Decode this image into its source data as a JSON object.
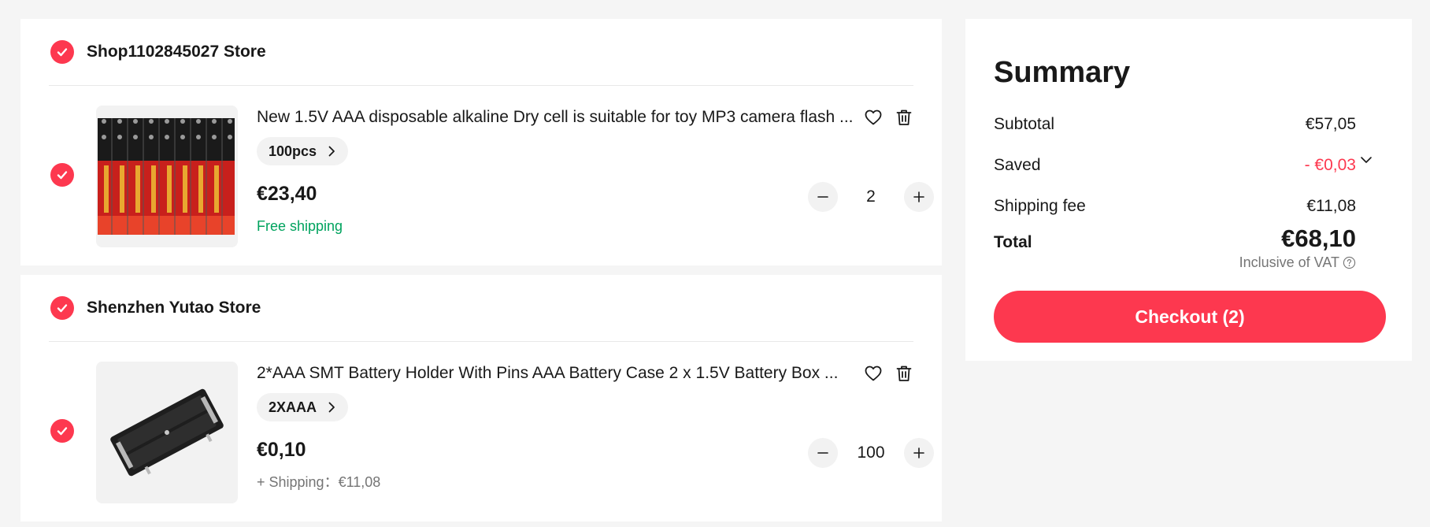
{
  "stores": [
    {
      "name": "Shop1102845027 Store",
      "item": {
        "title": "New 1.5V AAA disposable alkaline Dry cell is suitable for toy MP3 camera flash ...",
        "sku": "100pcs",
        "price": "€23,40",
        "shipping": "Free shipping",
        "quantity": "2"
      }
    },
    {
      "name": "Shenzhen Yutao Store",
      "item": {
        "title": "2*AAA SMT Battery Holder With Pins AAA Battery Case 2 x 1.5V Battery Box ...",
        "sku": "2XAAA",
        "price": "€0,10",
        "shipping": "+ Shipping：€11,08",
        "quantity": "100"
      }
    }
  ],
  "summary": {
    "title": "Summary",
    "subtotal_label": "Subtotal",
    "subtotal_value": "€57,05",
    "saved_label": "Saved",
    "saved_value": "- €0,03",
    "shipping_label": "Shipping fee",
    "shipping_value": "€11,08",
    "total_label": "Total",
    "total_value": "€68,10",
    "vat_note": "Inclusive of VAT",
    "checkout_label": "Checkout (2)"
  },
  "colors": {
    "accent": "#fd384f",
    "free_shipping": "#00a35e",
    "muted": "#757575"
  },
  "icons": [
    "check-icon",
    "heart-icon",
    "trash-icon",
    "chevron-right-icon",
    "minus-icon",
    "plus-icon",
    "chevron-down-icon",
    "help-circle-icon"
  ]
}
